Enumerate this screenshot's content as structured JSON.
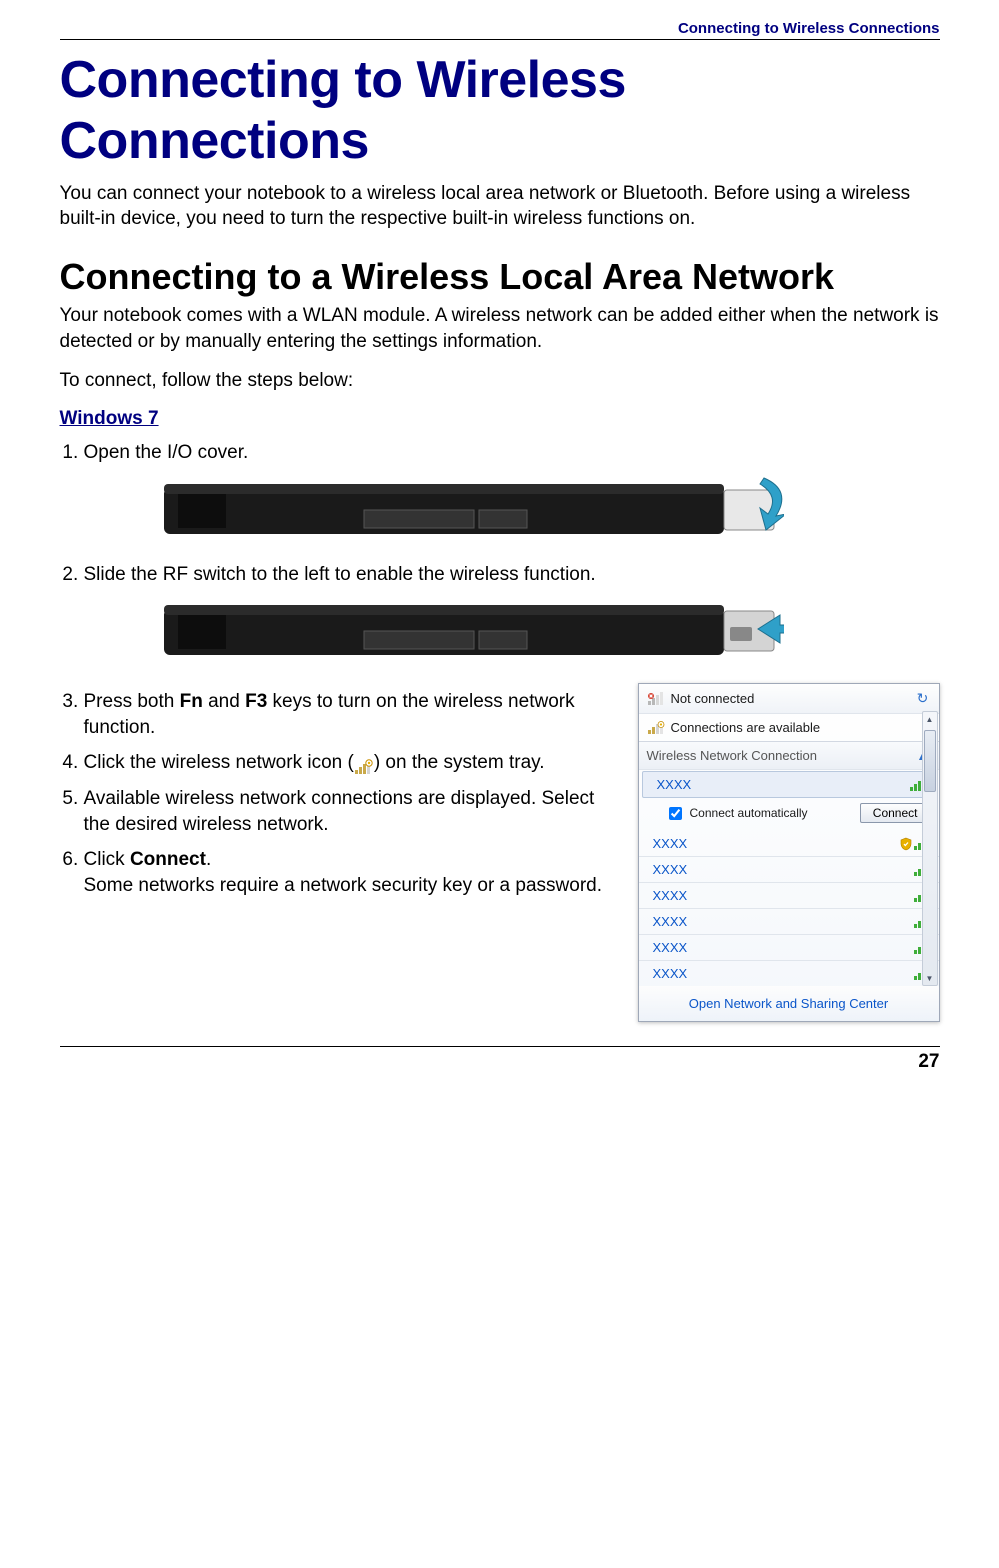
{
  "header": {
    "running_title": "Connecting to Wireless Connections"
  },
  "title": "Connecting to Wireless Connections",
  "intro": "You can connect your notebook to a wireless local area network or Bluetooth. Before using a wireless built-in device, you need to turn the respective built-in wireless functions on.",
  "section": {
    "title": "Connecting to a Wireless Local Area Network",
    "p1": "Your notebook comes with a WLAN module. A wireless network can be added either when the network is detected or by manually entering the settings information.",
    "p2": "To connect, follow the steps below:",
    "os_heading": "Windows 7"
  },
  "steps": {
    "s1": "Open the I/O cover.",
    "s2": "Slide the RF switch to the left to enable the wireless function.",
    "s3_a": "Press both ",
    "s3_fn": "Fn",
    "s3_b": " and ",
    "s3_f3": "F3",
    "s3_c": " keys to turn on the wireless network function.",
    "s4_a": "Click the wireless network icon (",
    "s4_b": ") on the system tray.",
    "s5": "Available wireless network connections are displayed. Select the desired wireless network.",
    "s6_a": "Click ",
    "s6_connect": "Connect",
    "s6_b": ".",
    "s6_c": "Some networks require a network security key or a password."
  },
  "popup": {
    "not_connected": "Not connected",
    "available": "Connections are available",
    "section_label": "Wireless Network Connection",
    "auto_label": "Connect automatically",
    "connect_btn": "Connect",
    "footer": "Open Network and Sharing Center",
    "networks": [
      "XXXX",
      "XXXX",
      "XXXX",
      "XXXX",
      "XXXX",
      "XXXX",
      "XXXX"
    ]
  },
  "page_number": "27"
}
